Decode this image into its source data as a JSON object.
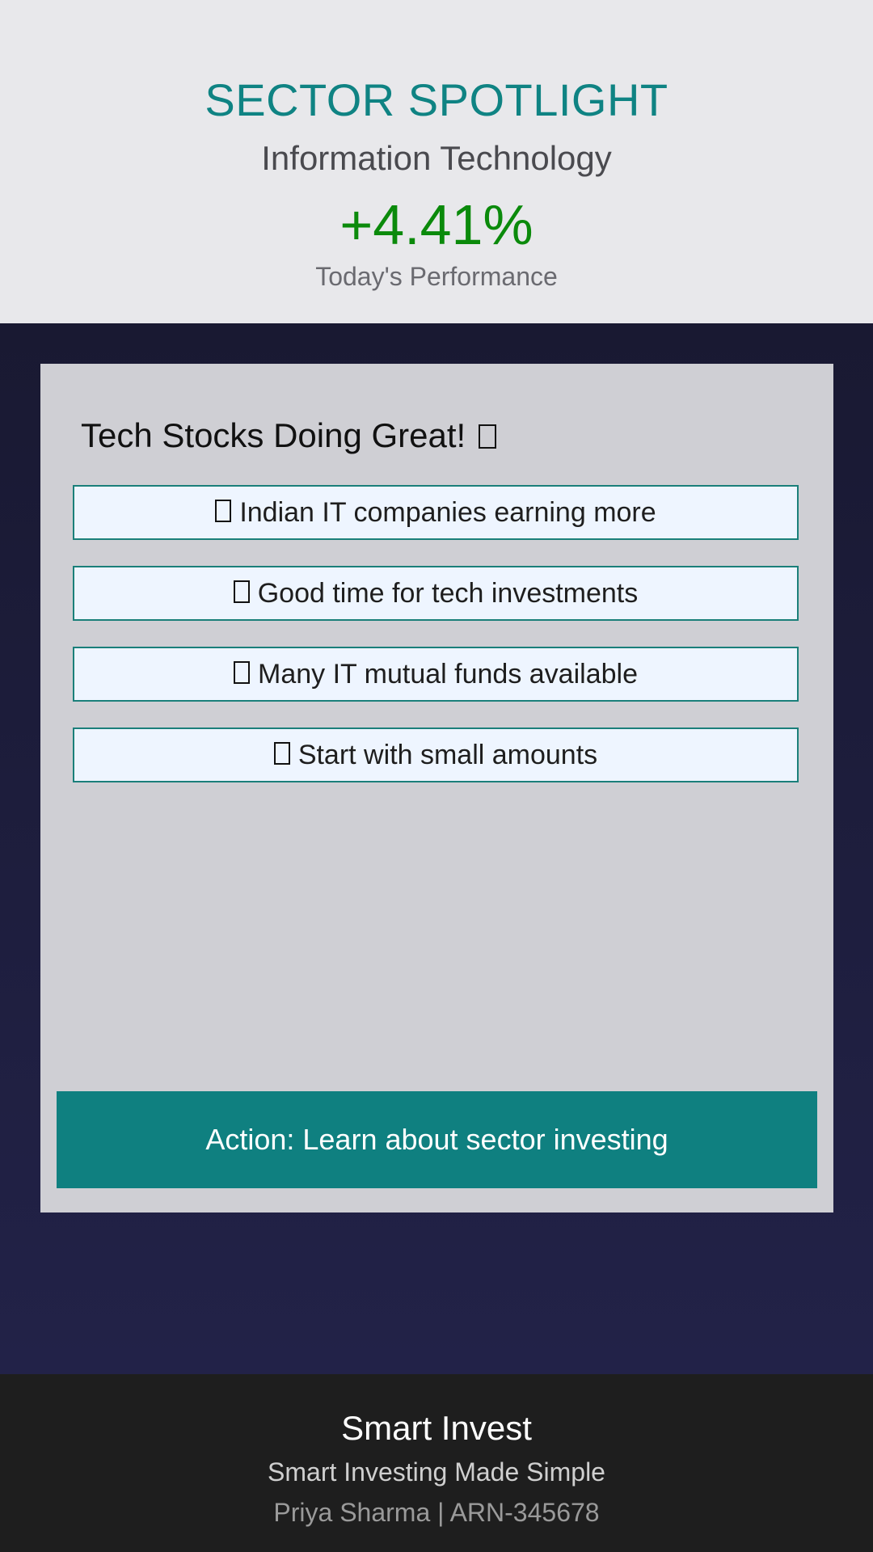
{
  "header": {
    "title": "SECTOR SPOTLIGHT",
    "sector": "Information Technology",
    "change": "+4.41%",
    "caption": "Today's Performance"
  },
  "card": {
    "title": "Tech Stocks Doing Great!",
    "title_icon": "box-icon",
    "bullets": [
      {
        "icon": "box-icon",
        "text": "Indian IT companies earning more"
      },
      {
        "icon": "box-icon",
        "text": "Good time for tech investments"
      },
      {
        "icon": "box-icon",
        "text": "Many IT mutual funds available"
      },
      {
        "icon": "box-icon",
        "text": "Start with small amounts"
      }
    ],
    "action_label": "Action: Learn about sector investing"
  },
  "footer": {
    "brand": "Smart Invest",
    "tagline": "Smart Investing Made Simple",
    "credit": "Priya Sharma | ARN-345678"
  },
  "colors": {
    "accent": "#0f8080",
    "positive": "#0b8a0b",
    "header_bg": "#e8e8eb",
    "card_bg": "#cfcfd4",
    "footer_bg": "#1e1e1e"
  }
}
